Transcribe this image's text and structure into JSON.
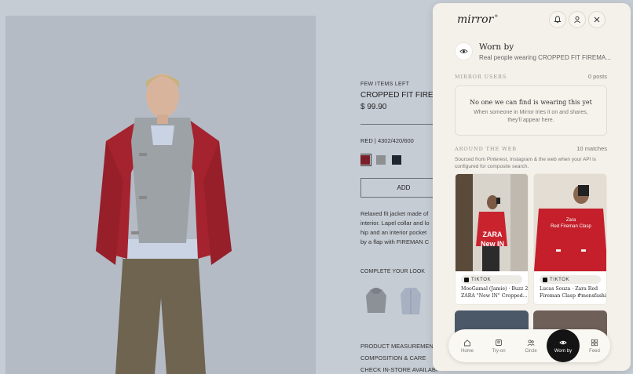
{
  "product_page": {
    "few_items": "FEW ITEMS LEFT",
    "name": "CROPPED FIT FIREM",
    "price": "$ 99.90",
    "color_ref": "RED | 4302/420/600",
    "swatch_colors": [
      "#7a1e2a",
      "#8d8f93",
      "#1f2630"
    ],
    "add_label": "ADD",
    "description_lines": [
      "Relaxed fit jacket made of",
      "interior. Lapel collar and lo",
      "hip and an interior pocket",
      "by a flap with FIREMAN C"
    ],
    "complete_your_look": "COMPLETE YOUR LOOK",
    "links": [
      "PRODUCT MEASUREMENT",
      "COMPOSITION & CARE",
      "CHECK IN-STORE AVAILABI"
    ]
  },
  "panel": {
    "logo": "mirror",
    "logo_mark": "®",
    "header_icons": [
      "bell-icon",
      "user-icon",
      "close-icon"
    ],
    "worn_by": {
      "title": "Worn by",
      "subtitle": "Real people wearing CROPPED FIT FIREMA..."
    },
    "mirror_users": {
      "title": "MIRROR USERS",
      "count": "0 posts",
      "empty_title": "No one we can find is wearing this yet",
      "empty_sub": "When someone in Mirror tries it on and shares, they'll appear here."
    },
    "around_web": {
      "title": "AROUND THE WEB",
      "count": "10 matches",
      "description": "Sourced from Pinterest, Instagram & the web when your API is configured for composite search."
    },
    "cards": [
      {
        "source": "TIKTOK",
        "overlay_line1": "ZARA",
        "overlay_line2": "New IN",
        "caption_lines": [
          "MooGamal (Jamie) · Buzz 2",
          "ZARA \"New IN\" Cropped..."
        ]
      },
      {
        "source": "TIKTOK",
        "overlay_line1": "Zara",
        "overlay_line2": "Red Fireman Clasp",
        "caption_lines": [
          "Lucas Souza · Zara Red",
          "Fireman Clasp #mensfashio..."
        ]
      }
    ],
    "nav": [
      {
        "label": "Home",
        "icon": "home-icon"
      },
      {
        "label": "Try-on",
        "icon": "try-on-icon"
      },
      {
        "label": "Circle",
        "icon": "people-icon"
      },
      {
        "label": "Worn by",
        "icon": "eye-icon",
        "active": true
      },
      {
        "label": "Feed",
        "icon": "grid-icon"
      }
    ]
  }
}
